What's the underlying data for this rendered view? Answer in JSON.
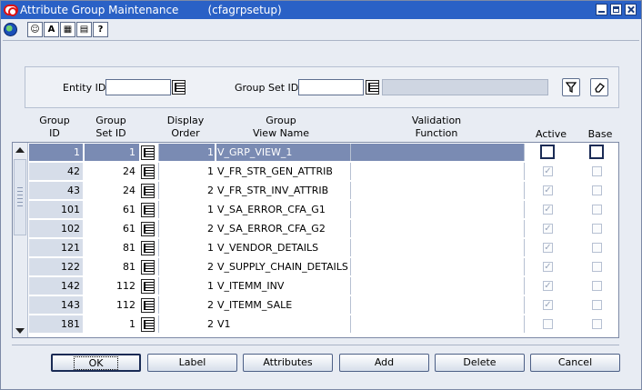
{
  "window": {
    "title": "Attribute Group Maintenance",
    "subtitle": "(cfagrpsetup)"
  },
  "toolbar": {
    "buttons": [
      {
        "name": "globe-icon",
        "label": ""
      },
      {
        "name": "smiley-icon",
        "label": "☺"
      },
      {
        "name": "font-icon",
        "label": "A"
      },
      {
        "name": "calendar-icon",
        "label": "▦"
      },
      {
        "name": "printer-icon",
        "label": "▤"
      },
      {
        "name": "help-icon",
        "label": "?"
      }
    ]
  },
  "search": {
    "entity_label": "Entity ID",
    "entity_value": "",
    "group_set_label": "Group Set ID",
    "group_set_value": "",
    "group_set_desc": ""
  },
  "columns": {
    "group_id": [
      "Group",
      "ID"
    ],
    "group_set_id": [
      "Group",
      "Set ID"
    ],
    "display_order": [
      "Display",
      "Order"
    ],
    "group_view": [
      "Group",
      "View Name"
    ],
    "validation": [
      "Validation",
      "Function"
    ],
    "active": "Active",
    "base": "Base"
  },
  "rows": [
    {
      "group_id": "1",
      "group_set_id": "1",
      "order": "1",
      "view": "V_GRP_VIEW_1",
      "active": false,
      "base": false,
      "selected": true
    },
    {
      "group_id": "42",
      "group_set_id": "24",
      "order": "1",
      "view": "V_FR_STR_GEN_ATTRIB",
      "active": true,
      "base": false
    },
    {
      "group_id": "43",
      "group_set_id": "24",
      "order": "2",
      "view": "V_FR_STR_INV_ATTRIB",
      "active": true,
      "base": false
    },
    {
      "group_id": "101",
      "group_set_id": "61",
      "order": "1",
      "view": "V_SA_ERROR_CFA_G1",
      "active": true,
      "base": false
    },
    {
      "group_id": "102",
      "group_set_id": "61",
      "order": "2",
      "view": "V_SA_ERROR_CFA_G2",
      "active": true,
      "base": false
    },
    {
      "group_id": "121",
      "group_set_id": "81",
      "order": "1",
      "view": "V_VENDOR_DETAILS",
      "active": true,
      "base": false
    },
    {
      "group_id": "122",
      "group_set_id": "81",
      "order": "2",
      "view": "V_SUPPLY_CHAIN_DETAILS",
      "active": true,
      "base": false
    },
    {
      "group_id": "142",
      "group_set_id": "112",
      "order": "1",
      "view": "V_ITEMM_INV",
      "active": true,
      "base": false
    },
    {
      "group_id": "143",
      "group_set_id": "112",
      "order": "2",
      "view": "V_ITEMM_SALE",
      "active": true,
      "base": false
    },
    {
      "group_id": "181",
      "group_set_id": "1",
      "order": "2",
      "view": "V1",
      "active": false,
      "base": false
    }
  ],
  "buttons": {
    "ok": "OK",
    "label": "Label",
    "attributes": "Attributes",
    "add": "Add",
    "delete": "Delete",
    "cancel": "Cancel"
  }
}
